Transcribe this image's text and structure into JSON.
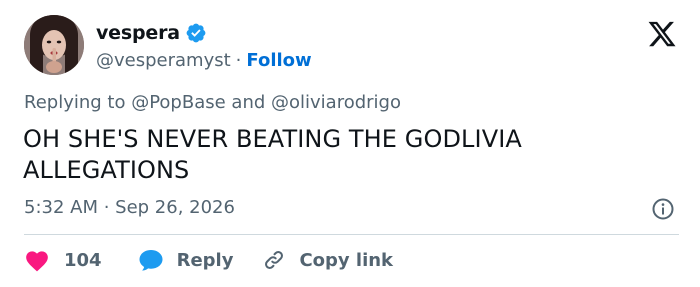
{
  "author": {
    "display_name": "vespera",
    "handle": "@vesperamyst",
    "separator": "·",
    "follow_label": "Follow"
  },
  "reply_context": {
    "prefix": "Replying to ",
    "mention_1": "@PopBase",
    "conjunction": " and ",
    "mention_2": "@oliviarodrigo"
  },
  "tweet": {
    "text": "OH SHE'S NEVER BEATING THE GODLIVIA ALLEGATIONS",
    "timestamp": "5:32 AM · Sep 26, 2026"
  },
  "actions": {
    "like_count": "104",
    "reply_label": "Reply",
    "copy_label": "Copy link"
  },
  "icons": {
    "verified": "verified-badge-icon",
    "x_logo": "x-logo-icon",
    "info": "info-icon",
    "heart": "heart-icon",
    "reply": "speech-bubble-icon",
    "link": "link-icon"
  },
  "colors": {
    "text_primary": "#0f1419",
    "text_secondary": "#536471",
    "follow_blue": "#006fd6",
    "verified_blue": "#1d9bf0",
    "heart_pink": "#f91880",
    "divider": "#cfd9de"
  }
}
